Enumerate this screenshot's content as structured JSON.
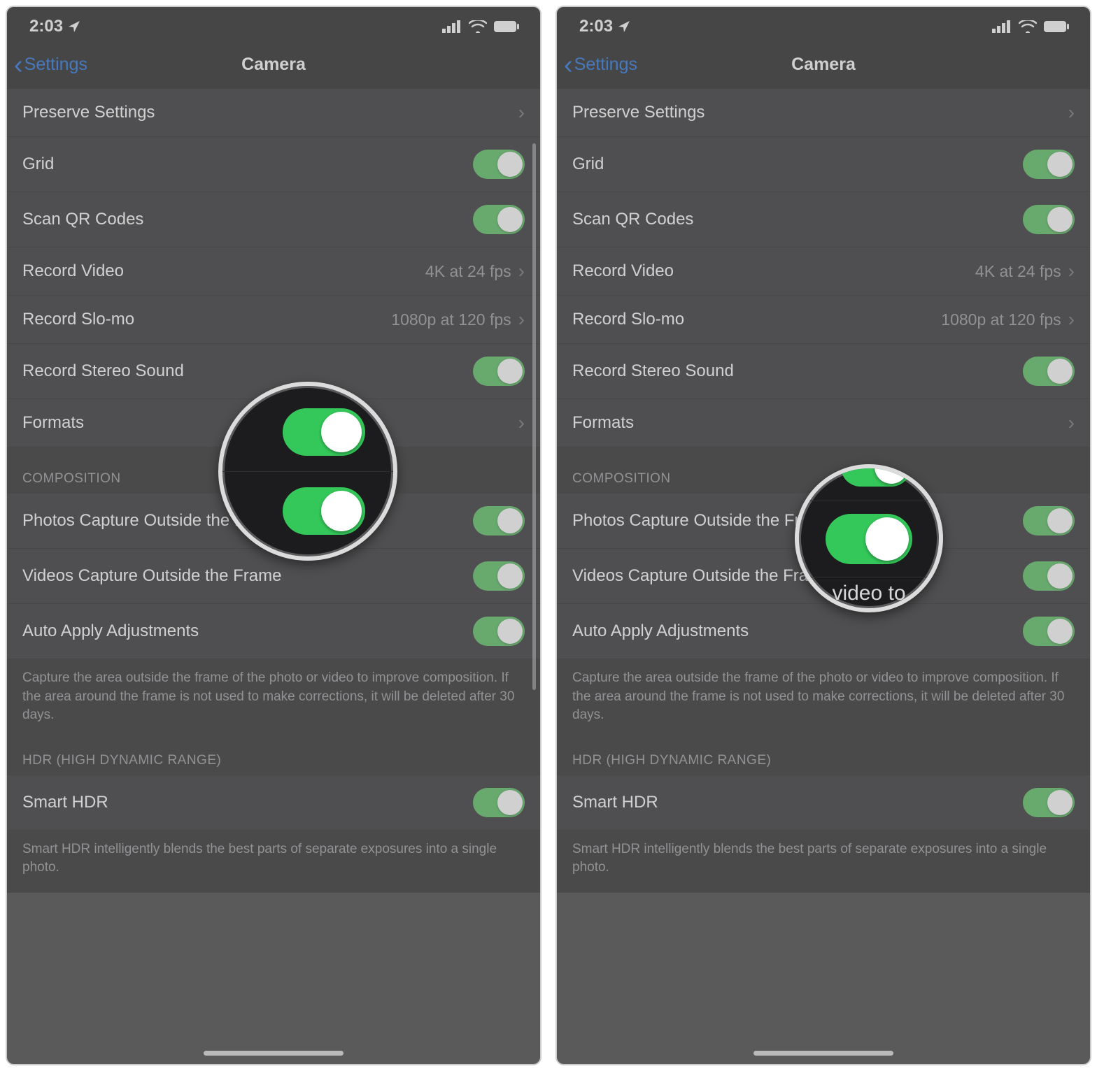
{
  "status": {
    "time": "2:03"
  },
  "nav": {
    "back": "Settings",
    "title": "Camera"
  },
  "rows": {
    "preserve": "Preserve Settings",
    "grid": "Grid",
    "qr": "Scan QR Codes",
    "recvideo": "Record Video",
    "recvideo_val": "4K at 24 fps",
    "slomo": "Record Slo-mo",
    "slomo_val": "1080p at 120 fps",
    "stereo": "Record Stereo Sound",
    "formats": "Formats"
  },
  "composition": {
    "header": "COMPOSITION",
    "photos": "Photos Capture Outside the Frame",
    "videos": "Videos Capture Outside the Frame",
    "auto": "Auto Apply Adjustments",
    "footer": "Capture the area outside the frame of the photo or video to improve composition. If the area around the frame is not used to make corrections, it will be deleted after 30 days."
  },
  "hdr": {
    "header": "HDR (HIGH DYNAMIC RANGE)",
    "smart": "Smart HDR",
    "footer": "Smart HDR intelligently blends the best parts of separate exposures into a single photo."
  },
  "mag2_text": "video to"
}
